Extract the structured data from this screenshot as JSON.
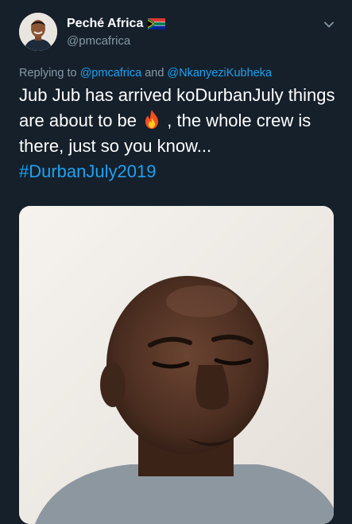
{
  "author": {
    "name": "Peché Africa",
    "handle": "@pmcafrica",
    "flag_icon": "south-africa-flag-icon"
  },
  "reply": {
    "prefix": "Replying to",
    "mention_1": "@pmcafrica",
    "connector": "and",
    "mention_2": "@NkanyeziKubheka"
  },
  "tweet": {
    "text_part_1": "Jub Jub has arrived koDurbanJuly things are about to be",
    "emoji": "fire-emoji-icon",
    "text_part_2": ", the whole crew is there, just so you know...",
    "hashtag": "#DurbanJuly2019"
  },
  "colors": {
    "background": "#15202b",
    "accent": "#1da1f2",
    "secondary_text": "#8899a6"
  }
}
